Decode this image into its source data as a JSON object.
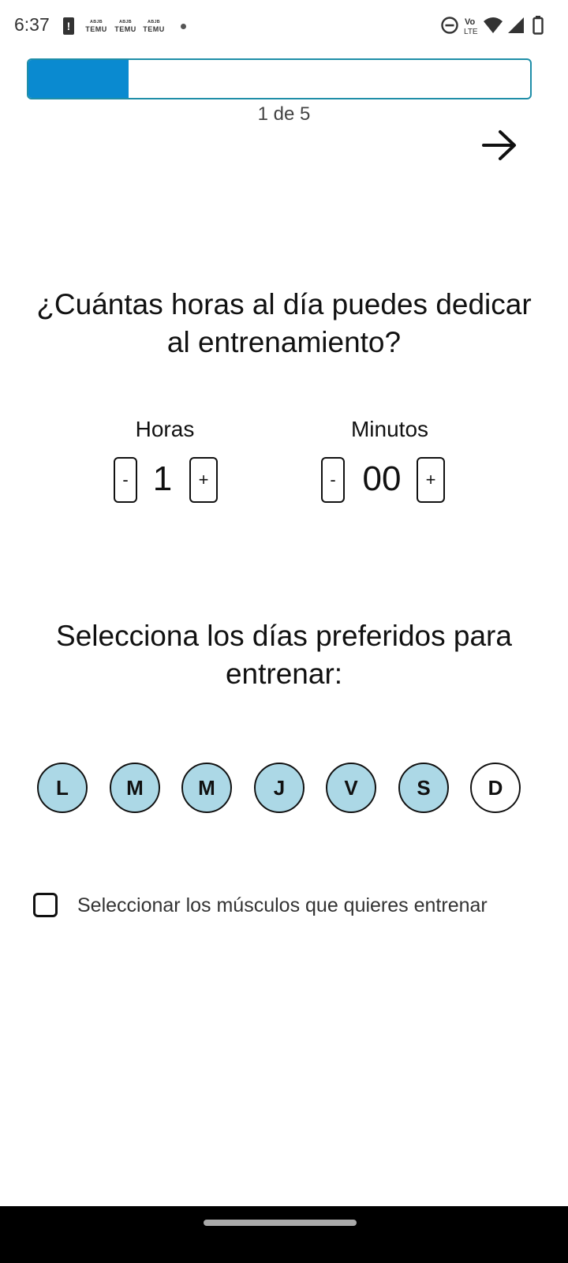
{
  "status_bar": {
    "time": "6:37",
    "alert_glyph": "!",
    "app_notifications": [
      {
        "top": "ᴬᴮᴶᴮ",
        "label": "TEMU"
      },
      {
        "top": "ᴬᴮᴶᴮ",
        "label": "TEMU"
      },
      {
        "top": "ᴬᴮᴶᴮ",
        "label": "TEMU"
      }
    ],
    "volte_label": "Vo LTE",
    "icons": [
      "alert-icon",
      "temu-notification-icon",
      "dnd-icon",
      "volte-icon",
      "wifi-icon",
      "signal-icon",
      "battery-icon"
    ]
  },
  "progress": {
    "fraction": 0.2,
    "label": "1 de 5",
    "fill_color": "#0a8ad0",
    "border_color": "#1f8ea8"
  },
  "next_button": {
    "icon": "arrow-right-icon"
  },
  "question": "¿Cuántas horas al día puedes dedicar al entrenamiento?",
  "hours": {
    "label": "Horas",
    "value": "1",
    "decrement": "-",
    "increment": "+"
  },
  "minutes": {
    "label": "Minutos",
    "value": "00",
    "decrement": "-",
    "increment": "+"
  },
  "days_title": "Selecciona los días preferidos para entrenar:",
  "days": [
    {
      "label": "L",
      "selected": true
    },
    {
      "label": "M",
      "selected": true
    },
    {
      "label": "M",
      "selected": true
    },
    {
      "label": "J",
      "selected": true
    },
    {
      "label": "V",
      "selected": true
    },
    {
      "label": "S",
      "selected": true
    },
    {
      "label": "D",
      "selected": false
    }
  ],
  "selected_day_color": "#acd8e6",
  "muscles_option": {
    "checked": false,
    "label": "Seleccionar los músculos que quieres entrenar"
  }
}
